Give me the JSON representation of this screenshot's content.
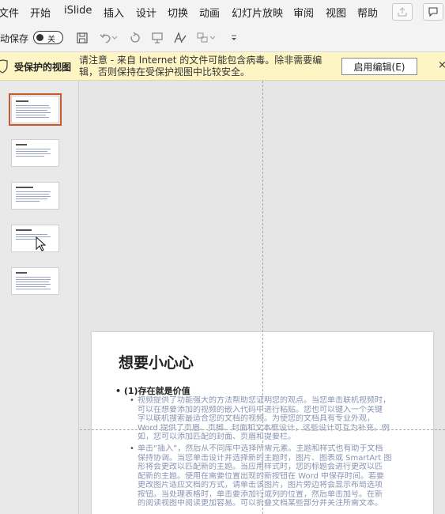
{
  "menubar": {
    "items": [
      "文件",
      "开始",
      "iSlide",
      "插入",
      "设计",
      "切换",
      "动画",
      "幻灯片放映",
      "审阅",
      "视图",
      "帮助"
    ]
  },
  "qat": {
    "autosave_label": "动保存",
    "autosave_state": "关"
  },
  "protected_bar": {
    "title": "受保护的视图",
    "message_line1": "请注意 - 来自 Internet 的文件可能包含病毒。除非需要编",
    "message_line2": "辑，否则保持在受保护视图中比较安全。",
    "enable_button": "启用编辑(E)",
    "close": "×"
  },
  "thumbnails": {
    "count": 5,
    "selected_index": 0
  },
  "slide": {
    "title": "想要小心心",
    "bullet": "• (1)存在就是价值",
    "para1_lines": [
      "视频提供了功能强大的方法帮助您证明您的观点。当您单击联机视频时，",
      "可以在想要添加的视频的嵌入代码中进行粘贴。您也可以键入一个关键",
      "字以联机搜索最适合您的文档的视频。为使您的文档具有专业外观，",
      "Word 提供了页眉、页脚、封面和文本框设计，这些设计可互为补充。例",
      "如，您可以添加匹配的封面、页眉和提要栏。"
    ],
    "para2_lines": [
      "单击“插入”，然后从不同库中选择所需元素。主题和样式也有助于文档",
      "保持协调。当您单击设计并选择新的主题时，图片、图表或 SmartArt 图",
      "形将会更改以匹配新的主题。当应用样式时，您的标题会进行更改以匹",
      "配新的主题。使用在需要位置出现的新按钮在 Word 中保存时间。若要",
      "更改图片适应文档的方式，请单击该图片，图片旁边将会显示布局选项",
      "按钮。当处理表格时，单击要添加行或列的位置，然后单击加号。在新",
      "的阅读视图中阅读更加容易。可以折叠文档某些部分并关注所需文本。"
    ]
  }
}
